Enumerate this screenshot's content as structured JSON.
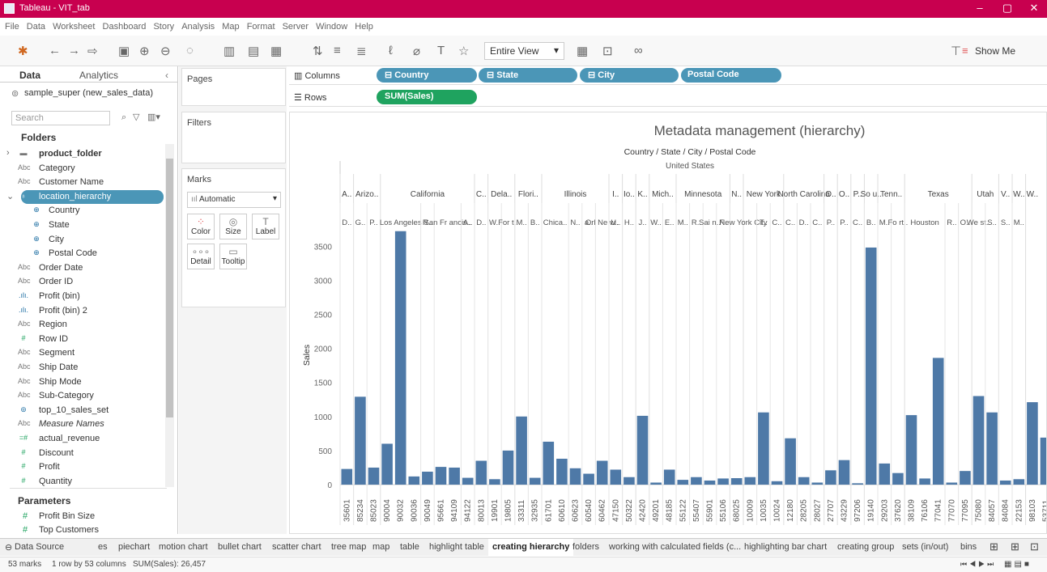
{
  "window": {
    "title": "Tableau - VIT_tab"
  },
  "menu": [
    "File",
    "Data",
    "Worksheet",
    "Dashboard",
    "Story",
    "Analysis",
    "Map",
    "Format",
    "Server",
    "Window",
    "Help"
  ],
  "toolbar": {
    "view_mode": "Entire View",
    "show_me": "Show Me"
  },
  "data_pane": {
    "tab_data": "Data",
    "tab_analytics": "Analytics",
    "datasource": "sample_super (new_sales_data)",
    "search_placeholder": "Search",
    "folders_header": "Folders",
    "fields": [
      {
        "icon": "folder",
        "label": "product_folder",
        "bold": true
      },
      {
        "icon": "Abc",
        "label": "Category"
      },
      {
        "icon": "Abc",
        "label": "Customer Name"
      },
      {
        "icon": "hier",
        "label": "location_hierarchy",
        "selected": true
      },
      {
        "icon": "globe",
        "label": "Country",
        "indent": true
      },
      {
        "icon": "globe",
        "label": "State",
        "indent": true
      },
      {
        "icon": "globe",
        "label": "City",
        "indent": true
      },
      {
        "icon": "globe",
        "label": "Postal Code",
        "indent": true
      },
      {
        "icon": "Abc",
        "label": "Order Date"
      },
      {
        "icon": "Abc",
        "label": "Order ID"
      },
      {
        "icon": ".ılı.",
        "label": "Profit (bin)"
      },
      {
        "icon": ".ılı.",
        "label": "Profit (bin) 2"
      },
      {
        "icon": "Abc",
        "label": "Region"
      },
      {
        "icon": "#",
        "label": "Row ID"
      },
      {
        "icon": "Abc",
        "label": "Segment"
      },
      {
        "icon": "Abc",
        "label": "Ship Date"
      },
      {
        "icon": "Abc",
        "label": "Ship Mode"
      },
      {
        "icon": "Abc",
        "label": "Sub-Category"
      },
      {
        "icon": "set",
        "label": "top_10_sales_set"
      },
      {
        "icon": "Abc",
        "label": "Measure Names",
        "italic": true
      },
      {
        "icon": "=#",
        "label": "actual_revenue"
      },
      {
        "icon": "#",
        "label": "Discount"
      },
      {
        "icon": "#",
        "label": "Profit"
      },
      {
        "icon": "#",
        "label": "Quantity"
      }
    ],
    "parameters_header": "Parameters",
    "parameters": [
      "Profit Bin Size",
      "Top Customers"
    ]
  },
  "cards": {
    "pages": "Pages",
    "filters": "Filters",
    "marks": "Marks",
    "mark_type": "Automatic",
    "buttons": [
      "Color",
      "Size",
      "Label",
      "Detail",
      "Tooltip"
    ]
  },
  "shelves": {
    "columns_label": "Columns",
    "rows_label": "Rows",
    "columns": [
      "Country",
      "State",
      "City",
      "Postal Code"
    ],
    "rows": [
      "SUM(Sales)"
    ]
  },
  "chart_data": {
    "type": "bar",
    "title": "Metadata management (hierarchy)",
    "header_title": "Country / State / City / Postal Code",
    "country": "United States",
    "ylabel": "Sales",
    "ylim": [
      0,
      3800
    ],
    "yticks": [
      0,
      500,
      1000,
      1500,
      2000,
      2500,
      3000,
      3500
    ],
    "states": [
      {
        "label": "A..",
        "span": 1
      },
      {
        "label": "Arizo..",
        "span": 2
      },
      {
        "label": "California",
        "span": 7
      },
      {
        "label": "C..",
        "span": 1
      },
      {
        "label": "Dela..",
        "span": 2
      },
      {
        "label": "Flori..",
        "span": 2
      },
      {
        "label": "Illinois",
        "span": 5
      },
      {
        "label": "I..",
        "span": 1
      },
      {
        "label": "Io..",
        "span": 1
      },
      {
        "label": "K..",
        "span": 1
      },
      {
        "label": "Mich..",
        "span": 2
      },
      {
        "label": "Minnesota",
        "span": 4
      },
      {
        "label": "N..",
        "span": 1
      },
      {
        "label": "New York",
        "span": 3
      },
      {
        "label": "North Carolina",
        "span": 3
      },
      {
        "label": "O..",
        "span": 1
      },
      {
        "label": "O..",
        "span": 1
      },
      {
        "label": "P..",
        "span": 1
      },
      {
        "label": "So u..",
        "span": 1
      },
      {
        "label": "Tenn..",
        "span": 2
      },
      {
        "label": "Texas",
        "span": 5
      },
      {
        "label": "Utah",
        "span": 2
      },
      {
        "label": "V..",
        "span": 1
      },
      {
        "label": "W..",
        "span": 1
      },
      {
        "label": "W..",
        "span": 1
      }
    ],
    "cities": [
      {
        "label": "D..",
        "span": 1
      },
      {
        "label": "G..",
        "span": 1
      },
      {
        "label": "P..",
        "span": 1
      },
      {
        "label": "Los Angeles",
        "span": 3
      },
      {
        "label": "R..",
        "span": 1
      },
      {
        "label": "San Fr ancis..",
        "span": 2
      },
      {
        "label": "A..",
        "span": 1
      },
      {
        "label": "D..",
        "span": 1
      },
      {
        "label": "W..",
        "span": 1
      },
      {
        "label": "For t..",
        "span": 1
      },
      {
        "label": "M..",
        "span": 1
      },
      {
        "label": "B..",
        "span": 1
      },
      {
        "label": "Chica..",
        "span": 2
      },
      {
        "label": "N..",
        "span": 1
      },
      {
        "label": "a..",
        "span": 1
      },
      {
        "label": "Orl Ne w..",
        "span": 1
      },
      {
        "label": "U..",
        "span": 1
      },
      {
        "label": "H..",
        "span": 1
      },
      {
        "label": "J..",
        "span": 1
      },
      {
        "label": "W..",
        "span": 1
      },
      {
        "label": "E..",
        "span": 1
      },
      {
        "label": "M..",
        "span": 1
      },
      {
        "label": "R..",
        "span": 1
      },
      {
        "label": "Sai n..",
        "span": 1
      },
      {
        "label": "F..",
        "span": 1
      },
      {
        "label": "New York City",
        "span": 2
      },
      {
        "label": "T..",
        "span": 1
      },
      {
        "label": "C..",
        "span": 1
      },
      {
        "label": "C..",
        "span": 1
      },
      {
        "label": "D..",
        "span": 1
      },
      {
        "label": "C..",
        "span": 1
      },
      {
        "label": "P..",
        "span": 1
      },
      {
        "label": "P..",
        "span": 1
      },
      {
        "label": "C..",
        "span": 1
      },
      {
        "label": "B..",
        "span": 1
      },
      {
        "label": "M..",
        "span": 1
      },
      {
        "label": "Fo rt..",
        "span": 1
      },
      {
        "label": "Houston",
        "span": 3
      },
      {
        "label": "R..",
        "span": 1
      },
      {
        "label": "O..",
        "span": 1
      },
      {
        "label": "We st..",
        "span": 1
      },
      {
        "label": "S..",
        "span": 1
      },
      {
        "label": "S..",
        "span": 1
      },
      {
        "label": "M..",
        "span": 1
      }
    ],
    "categories": [
      "35601",
      "85234",
      "85023",
      "90004",
      "90032",
      "90036",
      "90049",
      "95661",
      "94109",
      "94122",
      "80013",
      "19901",
      "19805",
      "33311",
      "32935",
      "61701",
      "60610",
      "60623",
      "60540",
      "60462",
      "47150",
      "50322",
      "42420",
      "49201",
      "48185",
      "55122",
      "55407",
      "55901",
      "55106",
      "68025",
      "10009",
      "10035",
      "10024",
      "12180",
      "28205",
      "28027",
      "27707",
      "43229",
      "97206",
      "19140",
      "29203",
      "37620",
      "38109",
      "76106",
      "77041",
      "77070",
      "77095",
      "75080",
      "84057",
      "84084",
      "22153",
      "98103",
      "53711"
    ],
    "values": [
      230,
      1290,
      250,
      600,
      3720,
      120,
      190,
      260,
      250,
      100,
      350,
      80,
      500,
      1000,
      100,
      630,
      380,
      240,
      160,
      350,
      220,
      110,
      1010,
      30,
      220,
      70,
      110,
      60,
      90,
      95,
      110,
      1060,
      50,
      680,
      110,
      30,
      210,
      360,
      20,
      3480,
      310,
      170,
      1020,
      90,
      1860,
      30,
      200,
      1300,
      1060,
      60,
      80,
      1210,
      690
    ]
  },
  "bottom_tabs": [
    "Data Source",
    "es",
    "piechart",
    "motion chart",
    "bullet chart",
    "scatter chart",
    "tree map",
    "map",
    "table",
    "highlight table",
    "creating hierarchy",
    "folders",
    "working with calculated fields (c...",
    "highlighting bar chart",
    "creating group",
    "sets (in/out)",
    "bins"
  ],
  "active_tab": "creating hierarchy",
  "status": {
    "marks": "53 marks",
    "rowscols": "1 row by 53 columns",
    "sum": "SUM(Sales): 26,457"
  },
  "colors": {
    "bar": "#4e79a7",
    "title_bar": "#c8004f",
    "pill_blue": "#4b96b7",
    "pill_green": "#1fa35f"
  }
}
